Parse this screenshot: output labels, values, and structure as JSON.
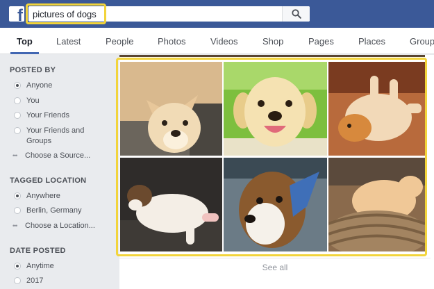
{
  "app": {
    "logo_letter": "f"
  },
  "search": {
    "value": "pictures of dogs",
    "button_icon": "magnifier-icon"
  },
  "tabs": [
    {
      "label": "Top",
      "active": true
    },
    {
      "label": "Latest"
    },
    {
      "label": "People"
    },
    {
      "label": "Photos"
    },
    {
      "label": "Videos"
    },
    {
      "label": "Shop"
    },
    {
      "label": "Pages"
    },
    {
      "label": "Places"
    },
    {
      "label": "Group"
    }
  ],
  "filters": {
    "posted_by": {
      "title": "POSTED BY",
      "options": [
        "Anyone",
        "You",
        "Your Friends",
        "Your Friends and Groups"
      ],
      "selected": "Anyone",
      "more": "Choose a Source..."
    },
    "tagged_location": {
      "title": "TAGGED LOCATION",
      "options": [
        "Anywhere",
        "Berlin, Germany"
      ],
      "selected": "Anywhere",
      "more": "Choose a Location..."
    },
    "date_posted": {
      "title": "DATE POSTED",
      "options": [
        "Anytime",
        "2017"
      ],
      "selected": "Anytime"
    }
  },
  "results": {
    "photos": [
      "dog-photo-1",
      "dog-photo-2",
      "dog-photo-3",
      "dog-photo-4",
      "dog-photo-5",
      "dog-photo-6"
    ],
    "see_all": "See all"
  },
  "colors": {
    "brand": "#3b5998",
    "highlight": "#f2d43b",
    "active_tab": "#4267b2"
  }
}
